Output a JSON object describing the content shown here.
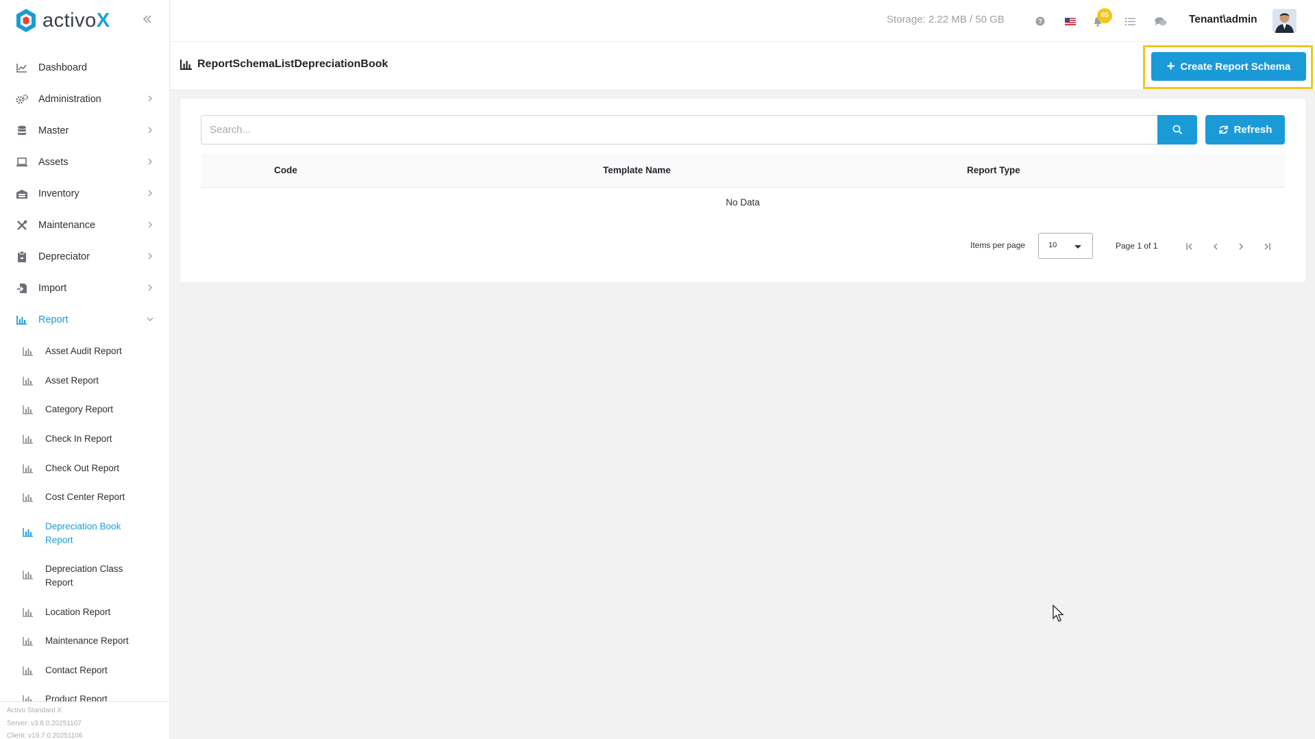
{
  "app": {
    "logo_prefix": "activo",
    "logo_suffix": "X"
  },
  "topbar": {
    "storage": "Storage: 2.22 MB / 50 GB",
    "notification_count": "65",
    "user": "Tenant\\admin"
  },
  "sidebar": {
    "items": [
      {
        "label": "Dashboard",
        "icon": "chart-line-icon"
      },
      {
        "label": "Administration",
        "icon": "gears-icon"
      },
      {
        "label": "Master",
        "icon": "database-icon"
      },
      {
        "label": "Assets",
        "icon": "laptop-icon"
      },
      {
        "label": "Inventory",
        "icon": "warehouse-icon"
      },
      {
        "label": "Maintenance",
        "icon": "tools-icon"
      },
      {
        "label": "Depreciator",
        "icon": "clipboard-icon"
      },
      {
        "label": "Import",
        "icon": "file-import-icon"
      },
      {
        "label": "Report",
        "icon": "bar-chart-icon"
      }
    ],
    "report_items": [
      "Asset Audit Report",
      "Asset Report",
      "Category Report",
      "Check In Report",
      "Check Out Report",
      "Cost Center Report",
      "Depreciation Book Report",
      "Depreciation Class Report",
      "Location Report",
      "Maintenance Report",
      "Contact Report",
      "Product Report"
    ],
    "footer": {
      "edition": "Activo Standard X",
      "server": "Server: v3.8.0.20251107",
      "client": "Client: v19.7.0.20251106"
    }
  },
  "page": {
    "title": "ReportSchemaListDepreciationBook",
    "create_button": "Create Report Schema"
  },
  "search": {
    "placeholder": "Search...",
    "value": ""
  },
  "refresh_label": "Refresh",
  "table": {
    "columns": [
      "Code",
      "Template Name",
      "Report Type"
    ],
    "empty_text": "No Data"
  },
  "pagination": {
    "items_per_page_label": "Items per page",
    "items_per_page": "10",
    "page_text": "Page 1 of 1"
  },
  "colors": {
    "accent": "#1a9bd7",
    "highlight": "#f3c51a",
    "badge": "#f5c518"
  }
}
